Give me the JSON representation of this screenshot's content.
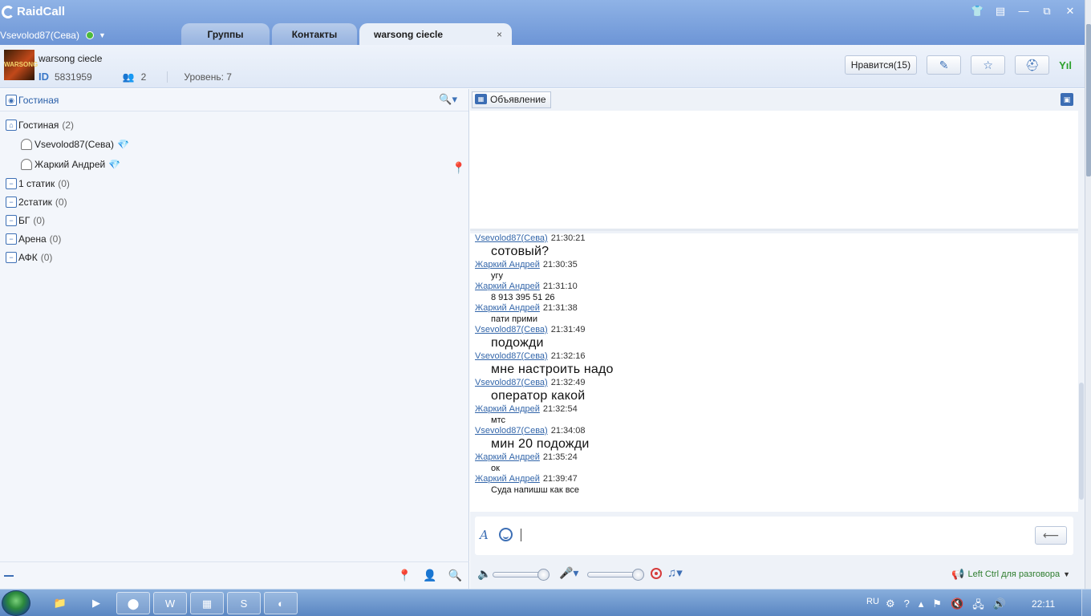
{
  "app": {
    "name": "RaidCall",
    "user": "Vsevolod87(Сева)"
  },
  "tabs": [
    {
      "label": "Группы"
    },
    {
      "label": "Контакты"
    },
    {
      "label": "warsong ciecle",
      "close": "×"
    }
  ],
  "window_controls": {
    "skin": "👕",
    "menu": "▤",
    "minimize": "—",
    "restore": "⧉",
    "close": "✕"
  },
  "channel": {
    "image_text": "WARSONG",
    "name": "warsong ciecle",
    "id_label": "ID",
    "id": "5831959",
    "members": "2",
    "level": "Уровень: 7",
    "like_button": "Нравится(15)"
  },
  "left": {
    "room_label": "Гостиная",
    "tree": [
      {
        "label": "Гостиная",
        "count": "(2)"
      },
      {
        "label": "Vsevolod87(Сева)",
        "user": true
      },
      {
        "label": "Жаркий Андрей",
        "user": true
      },
      {
        "label": "1 статик",
        "count": "(0)"
      },
      {
        "label": "2статик",
        "count": "(0)"
      },
      {
        "label": "БГ",
        "count": "(0)"
      },
      {
        "label": "Арена",
        "count": "(0)"
      },
      {
        "label": "АФК",
        "count": "(0)"
      }
    ]
  },
  "right": {
    "announcement_button": "Объявление",
    "messages": [
      {
        "who": "Vsevolod87(Сева)",
        "time": "21:30:21",
        "text": "сотовый?"
      },
      {
        "who": "Жаркий Андрей",
        "time": "21:30:35",
        "text": "угу"
      },
      {
        "who": "Жаркий Андрей",
        "time": "21:31:10",
        "text": "8 913 395 51 26"
      },
      {
        "who": "Жаркий Андрей",
        "time": "21:31:38",
        "text": "пати прими"
      },
      {
        "who": "Vsevolod87(Сева)",
        "time": "21:31:49",
        "text": "подожди"
      },
      {
        "who": "Vsevolod87(Сева)",
        "time": "21:32:16",
        "text": "мне настроить надо"
      },
      {
        "who": "Vsevolod87(Сева)",
        "time": "21:32:49",
        "text": "оператор какой"
      },
      {
        "who": "Жаркий Андрей",
        "time": "21:32:54",
        "text": "мтс"
      },
      {
        "who": "Vsevolod87(Сева)",
        "time": "21:34:08",
        "text": "мин 20 подожди"
      },
      {
        "who": "Жаркий Андрей",
        "time": "21:35:24",
        "text": "ок"
      },
      {
        "who": "Жаркий Андрей",
        "time": "21:39:47",
        "text": "Суда напишш как все"
      }
    ],
    "send_symbol": "⟵",
    "ptt_label": "Left Ctrl для разговора"
  },
  "taskbar": {
    "lang": "RU",
    "clock": "22:11"
  },
  "colors": {
    "accent": "#3d6fb5",
    "link": "#3366aa",
    "titlebar": "#7fa3dd"
  }
}
